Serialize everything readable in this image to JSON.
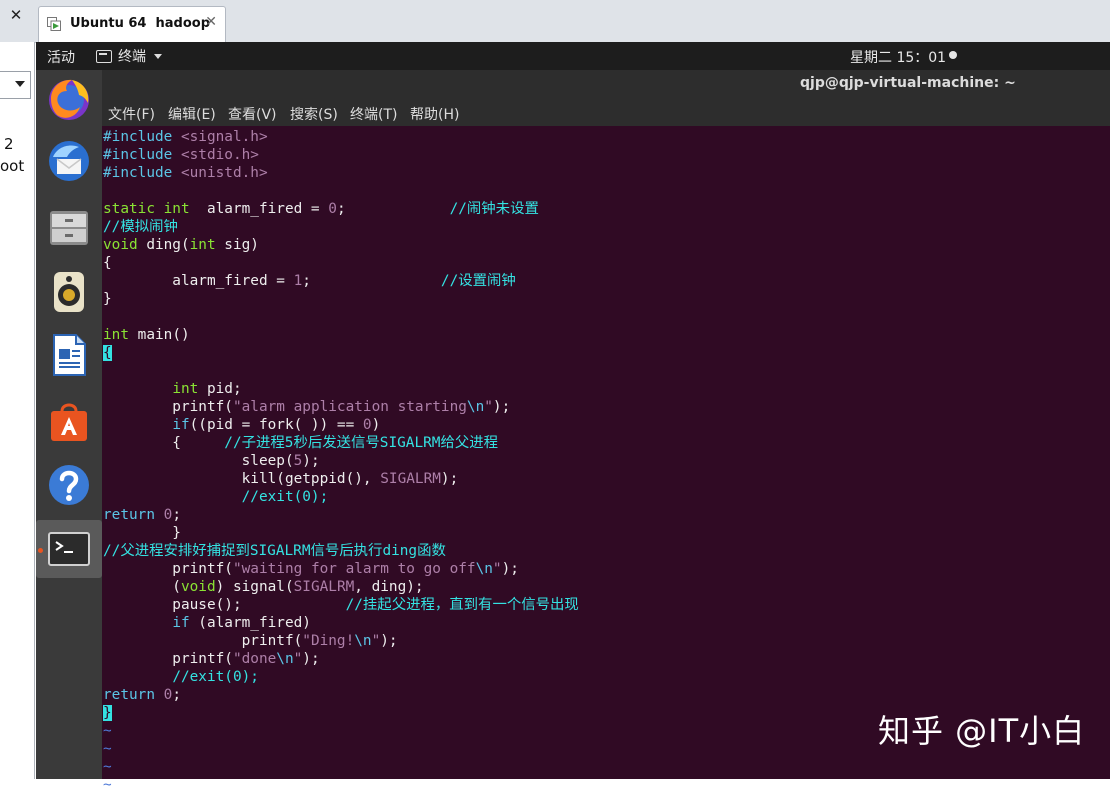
{
  "host": {
    "close_glyph": "✕",
    "tab_title": "Ubuntu 64  hadoop",
    "tab_close_glyph": "✕",
    "left_fragments": [
      "2",
      "oot"
    ]
  },
  "topbar": {
    "activities": "活动",
    "app_menu": "终端",
    "clock": "星期二 15：01"
  },
  "dock": {
    "items": [
      "firefox-icon",
      "thunderbird-icon",
      "files-icon",
      "rhythmbox-icon",
      "writer-icon",
      "software-center-icon",
      "help-icon",
      "terminal-icon"
    ]
  },
  "terminal": {
    "title": "qjp@qjp-virtual-machine: ~",
    "menu": [
      "文件(F)",
      "编辑(E)",
      "查看(V)",
      "搜索(S)",
      "终端(T)",
      "帮助(H)"
    ],
    "code_lines": [
      [
        [
          "inc",
          "#include "
        ],
        [
          "str",
          "<signal.h>"
        ]
      ],
      [
        [
          "inc",
          "#include "
        ],
        [
          "str",
          "<stdio.h>"
        ]
      ],
      [
        [
          "inc",
          "#include "
        ],
        [
          "str",
          "<unistd.h>"
        ]
      ],
      [],
      [
        [
          "ty",
          "static int"
        ],
        [
          "",
          "  alarm_fired = "
        ],
        [
          "num",
          "0"
        ],
        [
          "",
          ";            "
        ],
        [
          "cm",
          "//闹钟未设置"
        ]
      ],
      [
        [
          "cm",
          "//模拟闹钟"
        ]
      ],
      [
        [
          "ty",
          "void"
        ],
        [
          "",
          " ding("
        ],
        [
          "ty",
          "int"
        ],
        [
          "",
          " sig)"
        ]
      ],
      [
        [
          "",
          "{"
        ]
      ],
      [
        [
          "",
          "        alarm_fired = "
        ],
        [
          "num",
          "1"
        ],
        [
          "",
          ";               "
        ],
        [
          "cm",
          "//设置闹钟"
        ]
      ],
      [
        [
          "",
          "}"
        ]
      ],
      [],
      [
        [
          "ty",
          "int"
        ],
        [
          "",
          " main()"
        ]
      ],
      [
        [
          "cursor",
          "{"
        ]
      ],
      [],
      [
        [
          "",
          "        "
        ],
        [
          "ty",
          "int"
        ],
        [
          "",
          " pid;"
        ]
      ],
      [
        [
          "",
          "        printf("
        ],
        [
          "str",
          "\"alarm application starting"
        ],
        [
          "kw",
          "\\n"
        ],
        [
          "str",
          "\""
        ],
        [
          "",
          ");"
        ]
      ],
      [
        [
          "",
          "        "
        ],
        [
          "kw",
          "if"
        ],
        [
          "",
          "((pid = fork( )) == "
        ],
        [
          "num",
          "0"
        ],
        [
          "",
          ")"
        ]
      ],
      [
        [
          "",
          "        {     "
        ],
        [
          "cm",
          "//子进程5秒后发送信号SIGALRM给父进程"
        ]
      ],
      [
        [
          "",
          "                sleep("
        ],
        [
          "num",
          "5"
        ],
        [
          "",
          ");"
        ]
      ],
      [
        [
          "",
          "                kill(getppid(), "
        ],
        [
          "str",
          "SIGALRM"
        ],
        [
          "",
          ");"
        ]
      ],
      [
        [
          "",
          "                "
        ],
        [
          "cm",
          "//exit(0);"
        ]
      ],
      [
        [
          "kw",
          "return"
        ],
        [
          "",
          " "
        ],
        [
          "num",
          "0"
        ],
        [
          "",
          ";"
        ]
      ],
      [
        [
          "",
          "        }"
        ]
      ],
      [
        [
          "cm",
          "//父进程安排好捕捉到SIGALRM信号后执行ding函数"
        ]
      ],
      [
        [
          "",
          "        printf("
        ],
        [
          "str",
          "\"waiting for alarm to go off"
        ],
        [
          "kw",
          "\\n"
        ],
        [
          "str",
          "\""
        ],
        [
          "",
          ");"
        ]
      ],
      [
        [
          "",
          "        ("
        ],
        [
          "ty",
          "void"
        ],
        [
          "",
          ") signal("
        ],
        [
          "str",
          "SIGALRM"
        ],
        [
          "",
          ", ding);"
        ]
      ],
      [
        [
          "",
          "        pause();            "
        ],
        [
          "cm",
          "//挂起父进程，直到有一个信号出现"
        ]
      ],
      [
        [
          "",
          "        "
        ],
        [
          "kw",
          "if"
        ],
        [
          "",
          " (alarm_fired)"
        ]
      ],
      [
        [
          "",
          "                printf("
        ],
        [
          "str",
          "\"Ding!"
        ],
        [
          "kw",
          "\\n"
        ],
        [
          "str",
          "\""
        ],
        [
          "",
          ");"
        ]
      ],
      [
        [
          "",
          "        printf("
        ],
        [
          "str",
          "\"done"
        ],
        [
          "kw",
          "\\n"
        ],
        [
          "str",
          "\""
        ],
        [
          "",
          ");"
        ]
      ],
      [
        [
          "",
          "        "
        ],
        [
          "cm",
          "//exit(0);"
        ]
      ],
      [
        [
          "kw",
          "return"
        ],
        [
          "",
          " "
        ],
        [
          "num",
          "0"
        ],
        [
          "",
          ";"
        ]
      ],
      [
        [
          "cursor",
          "}"
        ]
      ],
      [
        [
          "tilde",
          "~"
        ]
      ],
      [
        [
          "tilde",
          "~"
        ]
      ],
      [
        [
          "tilde",
          "~"
        ]
      ],
      [
        [
          "tilde",
          "~"
        ]
      ]
    ]
  },
  "watermark": "知乎 @IT小白",
  "colors": {
    "terminal_bg": "#300a24",
    "keyword": "#5bc5e6",
    "type": "#8ae234",
    "string": "#ad7fa8",
    "comment": "#34e2e2",
    "dock_bg": "#3a3a3a"
  }
}
